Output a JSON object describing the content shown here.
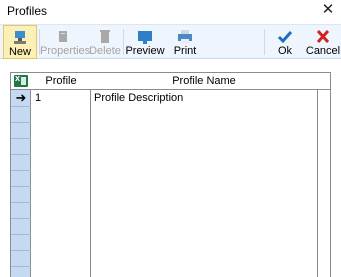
{
  "window": {
    "title": "Profiles",
    "close_glyph": "✕"
  },
  "toolbar": {
    "new_label": "New",
    "properties_label": "Properties",
    "delete_label": "Delete",
    "preview_label": "Preview",
    "print_label": "Print",
    "ok_label": "Ok",
    "cancel_label": "Cancel"
  },
  "grid": {
    "columns": [
      "Profile",
      "Profile Name"
    ],
    "rows": [
      {
        "profile": "1",
        "name": "Profile Description"
      }
    ],
    "current_row_glyph": "➜"
  },
  "colors": {
    "toolbar_bg": "#eef5fd",
    "rowheader_bg": "#c5d9f1",
    "ok_blue": "#1b6ec2",
    "cancel_red": "#d32020",
    "excel_green": "#1e7b45"
  }
}
